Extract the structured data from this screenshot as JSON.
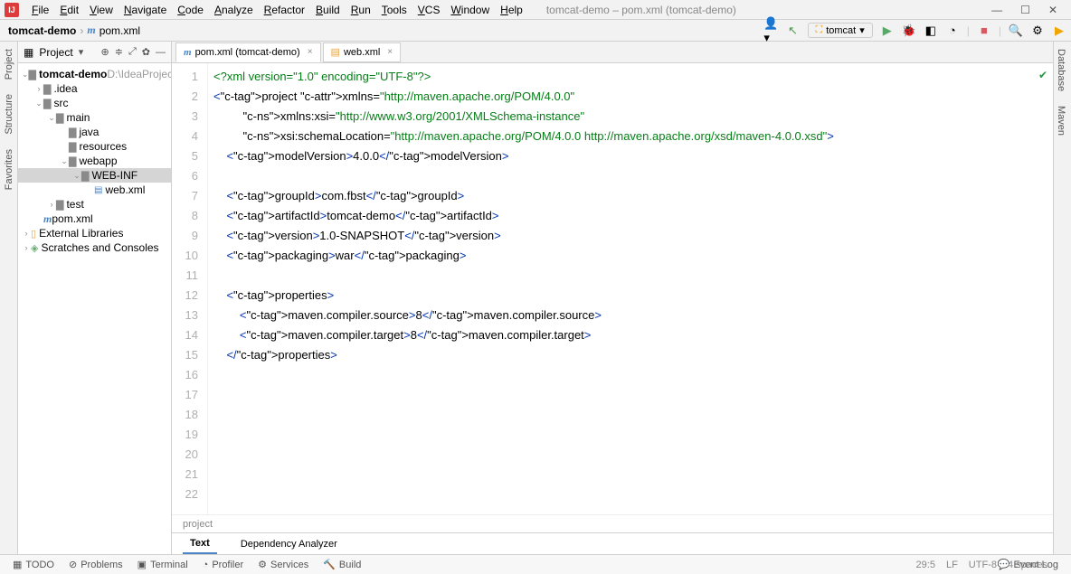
{
  "menubar": {
    "items": [
      "File",
      "Edit",
      "View",
      "Navigate",
      "Code",
      "Analyze",
      "Refactor",
      "Build",
      "Run",
      "Tools",
      "VCS",
      "Window",
      "Help"
    ],
    "title": "tomcat-demo – pom.xml (tomcat-demo)"
  },
  "breadcrumb": {
    "project": "tomcat-demo",
    "file": "pom.xml",
    "run_config": "tomcat"
  },
  "left_tools": [
    "Project",
    "Structure",
    "Favorites"
  ],
  "right_tools": [
    "Database",
    "Maven"
  ],
  "project_panel": {
    "title": "Project",
    "tree": [
      {
        "depth": 0,
        "exp": "v",
        "icon": "folder",
        "label": "tomcat-demo",
        "suffix": "D:\\IdeaProjects\\",
        "bold": true
      },
      {
        "depth": 1,
        "exp": ">",
        "icon": "folder",
        "label": ".idea"
      },
      {
        "depth": 1,
        "exp": "v",
        "icon": "folder",
        "label": "src"
      },
      {
        "depth": 2,
        "exp": "v",
        "icon": "folder",
        "label": "main"
      },
      {
        "depth": 3,
        "exp": "",
        "icon": "folder",
        "label": "java"
      },
      {
        "depth": 3,
        "exp": "",
        "icon": "folder",
        "label": "resources"
      },
      {
        "depth": 3,
        "exp": "v",
        "icon": "folder",
        "label": "webapp"
      },
      {
        "depth": 4,
        "exp": "v",
        "icon": "folder",
        "label": "WEB-INF",
        "selected": true
      },
      {
        "depth": 5,
        "exp": "",
        "icon": "file",
        "label": "web.xml"
      },
      {
        "depth": 2,
        "exp": ">",
        "icon": "folder",
        "label": "test"
      },
      {
        "depth": 1,
        "exp": "",
        "icon": "m",
        "label": "pom.xml"
      },
      {
        "depth": 0,
        "exp": ">",
        "icon": "lib",
        "label": "External Libraries"
      },
      {
        "depth": 0,
        "exp": ">",
        "icon": "scratch",
        "label": "Scratches and Consoles"
      }
    ]
  },
  "tabs": [
    {
      "icon": "m",
      "label": "pom.xml (tomcat-demo)",
      "active": true
    },
    {
      "icon": "file",
      "label": "web.xml",
      "active": false
    }
  ],
  "code": {
    "lines": [
      "<?xml version=\"1.0\" encoding=\"UTF-8\"?>",
      "<project xmlns=\"http://maven.apache.org/POM/4.0.0\"",
      "         xmlns:xsi=\"http://www.w3.org/2001/XMLSchema-instance\"",
      "         xsi:schemaLocation=\"http://maven.apache.org/POM/4.0.0 http://maven.apache.org/xsd/maven-4.0.0.xsd\">",
      "    <modelVersion>4.0.0</modelVersion>",
      "",
      "    <groupId>com.fbst</groupId>",
      "    <artifactId>tomcat-demo</artifactId>",
      "    <version>1.0-SNAPSHOT</version>",
      "    <packaging>war</packaging>",
      "",
      "    <properties>",
      "        <maven.compiler.source>8</maven.compiler.source>",
      "        <maven.compiler.target>8</maven.compiler.target>",
      "    </properties>"
    ],
    "breadcrumb": "project"
  },
  "editor_bottom_tabs": [
    "Text",
    "Dependency Analyzer"
  ],
  "bottom_bar": {
    "left": [
      "TODO",
      "Problems",
      "Terminal",
      "Profiler",
      "Services",
      "Build"
    ],
    "right": "Event Log"
  },
  "status": {
    "pos": "29:5",
    "sep": "LF",
    "enc": "UTF-8",
    "indent": "4 spaces"
  }
}
